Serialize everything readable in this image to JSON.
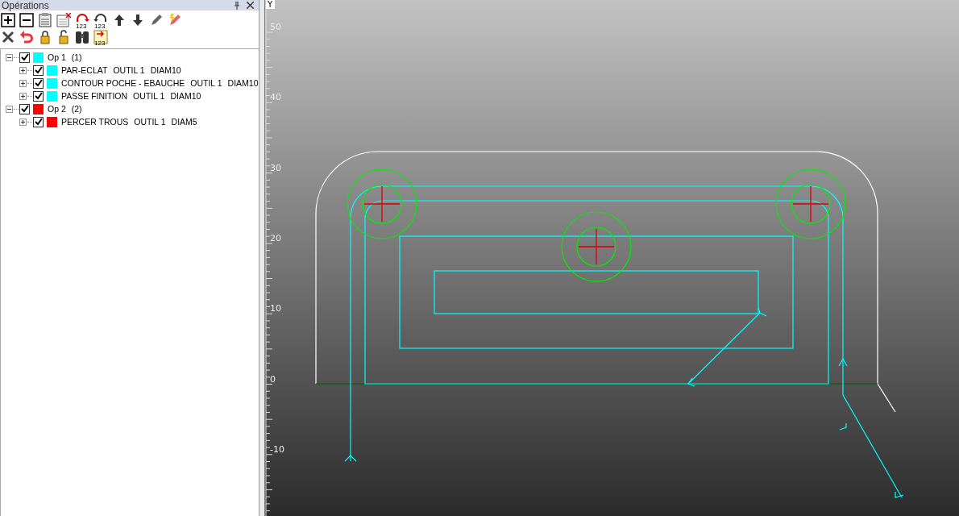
{
  "panel": {
    "title": "Opérations"
  },
  "toolbar_rows": [
    [
      {
        "kind": "add"
      },
      {
        "kind": "remove"
      },
      {
        "kind": "clipboard"
      },
      {
        "kind": "delete-list"
      },
      {
        "kind": "renumber",
        "badge": "123"
      },
      {
        "kind": "renumber-back",
        "badge": "123"
      },
      {
        "kind": "up"
      },
      {
        "kind": "down"
      },
      {
        "kind": "pencil"
      },
      {
        "kind": "lightning"
      }
    ],
    [
      {
        "kind": "close"
      },
      {
        "kind": "undo"
      },
      {
        "kind": "lock"
      },
      {
        "kind": "unlock"
      },
      {
        "kind": "binoculars"
      },
      {
        "kind": "insert",
        "badge": "123"
      }
    ]
  ],
  "operations": [
    {
      "label": "Op 1",
      "count": "(1)",
      "checked": true,
      "expanded": true,
      "color": "#00ffff",
      "children": [
        {
          "label": "PAR-ECLAT",
          "tool": "OUTIL 1",
          "diameter": "DIAM10",
          "checked": true,
          "expanded": false,
          "color": "#00ffff"
        },
        {
          "label": "CONTOUR POCHE - EBAUCHE",
          "tool": "OUTIL 1",
          "diameter": "DIAM10",
          "checked": true,
          "expanded": false,
          "color": "#00ffff"
        },
        {
          "label": "PASSE FINITION",
          "tool": "OUTIL 1",
          "diameter": "DIAM10",
          "checked": true,
          "expanded": false,
          "color": "#00ffff"
        }
      ]
    },
    {
      "label": "Op 2",
      "count": "(2)",
      "checked": true,
      "expanded": true,
      "color": "#ff0000",
      "children": [
        {
          "label": "PERCER TROUS",
          "tool": "OUTIL 1",
          "diameter": "DIAM5",
          "checked": true,
          "expanded": false,
          "color": "#ff0000"
        }
      ]
    }
  ],
  "viewport": {
    "axis_title": "Y",
    "axis_labels": [
      "50",
      "40",
      "30",
      "20",
      "10",
      "0",
      "-10"
    ]
  }
}
